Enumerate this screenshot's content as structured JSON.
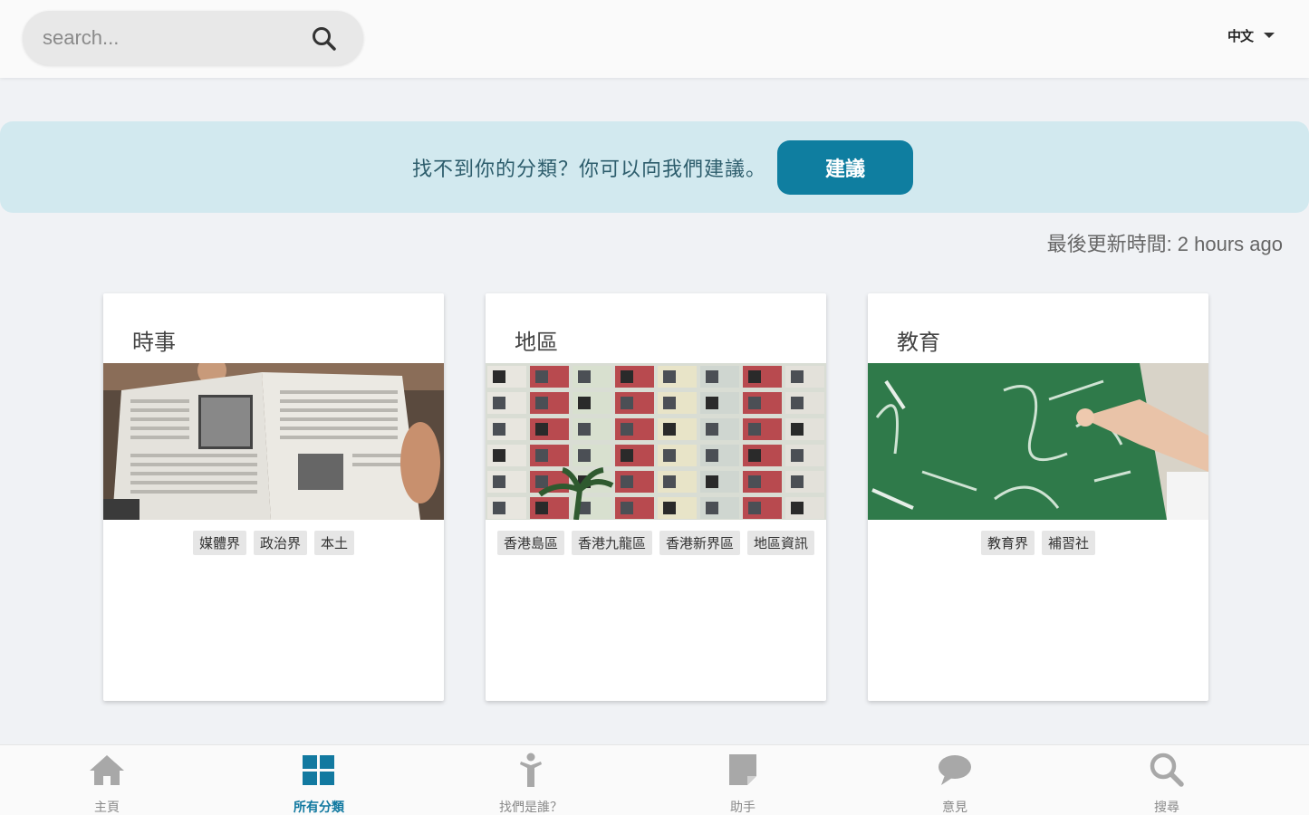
{
  "header": {
    "search_placeholder": "search...",
    "search_icon": "search-icon",
    "language_label": "中文",
    "language_icon": "chevron-down-icon"
  },
  "banner": {
    "text": "找不到你的分類？你可以向我們建議。",
    "button_label": "建議"
  },
  "last_updated": "最後更新時間: 2 hours ago",
  "categories": [
    {
      "title": "時事",
      "image": "newspaper-photo",
      "tags": [
        "媒體界",
        "政治界",
        "本土"
      ]
    },
    {
      "title": "地區",
      "image": "hong-kong-building-photo",
      "tags": [
        "香港島區",
        "香港九龍區",
        "香港新界區",
        "地區資訊"
      ]
    },
    {
      "title": "教育",
      "image": "chalkboard-photo",
      "tags": [
        "教育界",
        "補習社"
      ]
    }
  ],
  "bottom_nav": [
    {
      "label": "主頁",
      "icon": "home-icon",
      "active": false
    },
    {
      "label": "所有分類",
      "icon": "grid-icon",
      "active": true
    },
    {
      "label": "找們是誰？",
      "icon": "person-icon",
      "active": false
    },
    {
      "label": "助手",
      "icon": "note-icon",
      "active": false
    },
    {
      "label": "意見",
      "icon": "chat-icon",
      "active": false
    },
    {
      "label": "搜尋",
      "icon": "search-icon",
      "active": false
    }
  ],
  "colors": {
    "accent": "#0f7ea0",
    "banner_bg": "#d2e9ef",
    "banner_text": "#2d5d6c",
    "nav_inactive": "#a8a8a8"
  }
}
